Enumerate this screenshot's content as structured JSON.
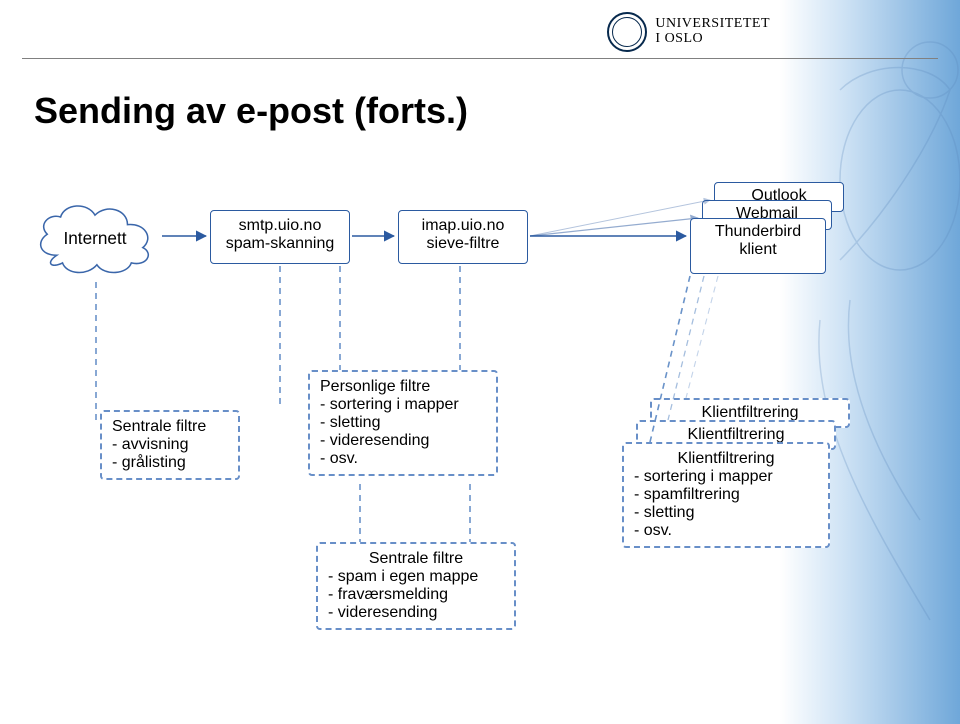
{
  "header": {
    "org_line1": "UNIVERSITETET",
    "org_line2": "I OSLO"
  },
  "title": "Sending av e-post (forts.)",
  "flow": {
    "internet": "Internett",
    "smtp": {
      "host": "smtp.uio.no",
      "sub": "spam-skanning"
    },
    "imap": {
      "host": "imap.uio.no",
      "sub": "sieve-filtre"
    },
    "clients": {
      "outlook": "Outlook",
      "webmail": "Webmail",
      "thunderbird": "Thunderbird",
      "klient": "klient"
    }
  },
  "filters": {
    "central_left": {
      "title": "Sentrale filtre",
      "items": [
        "- avvisning",
        "- grålisting"
      ]
    },
    "personal": {
      "title": "Personlige filtre",
      "items": [
        "- sortering i mapper",
        "- sletting",
        "- videresending",
        "- osv."
      ]
    },
    "central_mid": {
      "title": "Sentrale filtre",
      "items": [
        "- spam i egen mappe",
        "- fraværsmelding",
        "- videresending"
      ]
    },
    "client_filt": {
      "title_back2": "Klientfiltrering",
      "title_back1": "Klientfiltrering",
      "title": "Klientfiltrering",
      "items": [
        "- sortering i mapper",
        "- spamfiltrering",
        "- sletting",
        "- osv."
      ]
    }
  }
}
